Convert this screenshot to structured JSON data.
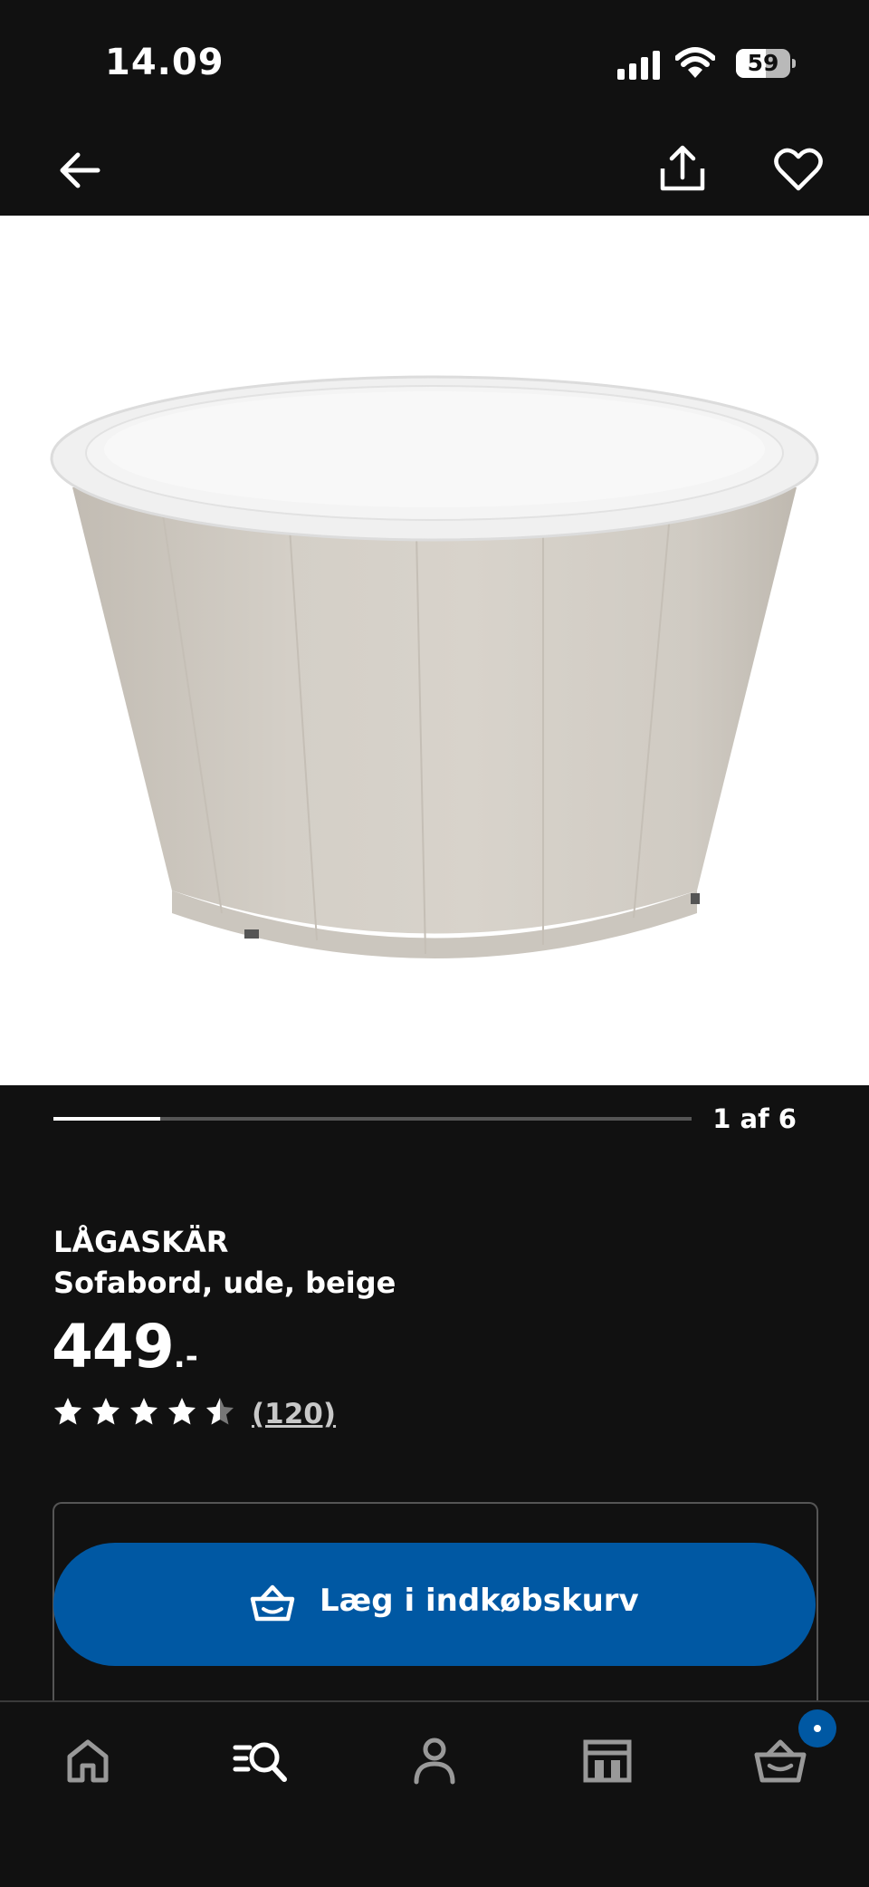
{
  "status_bar": {
    "time": "14.09",
    "battery_level": "59"
  },
  "header": {
    "back_icon": "arrow-left-icon",
    "share_icon": "share-icon",
    "favorite_icon": "heart-icon"
  },
  "gallery": {
    "counter": "1 af 6",
    "current_index": 1,
    "total_images": 6,
    "progress_fraction": 0.167
  },
  "product": {
    "name": "LÅGASKÄR",
    "description": "Sofabord, ude, beige",
    "price": "449",
    "price_suffix": ".-",
    "rating": 4.5,
    "rating_max": 5,
    "review_count": "(120)"
  },
  "actions": {
    "add_to_cart_label": "Læg i indkøbskurv",
    "add_to_cart_icon": "basket-icon"
  },
  "bottom_nav": {
    "items": [
      {
        "name": "home",
        "icon": "home-icon"
      },
      {
        "name": "search",
        "icon": "search-icon"
      },
      {
        "name": "profile",
        "icon": "user-icon"
      },
      {
        "name": "stores",
        "icon": "store-icon"
      },
      {
        "name": "cart",
        "icon": "basket-icon"
      }
    ]
  },
  "colors": {
    "background": "#111111",
    "accent": "#0058a3",
    "text": "#ffffff"
  }
}
